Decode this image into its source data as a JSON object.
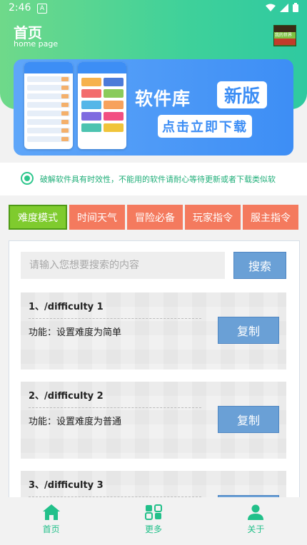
{
  "status_bar": {
    "time": "2:46",
    "a_icon": "A"
  },
  "header": {
    "title": "首页",
    "subtitle": "home page",
    "avatar_text": "我的世界"
  },
  "banner": {
    "headline": "软件库",
    "badge": "新版",
    "cta": "点击立即下载"
  },
  "notice": {
    "text": "破解软件具有时效性，不能用的软件请耐心等待更新或者下载类似软"
  },
  "tabs": [
    {
      "label": "难度模式",
      "active": true
    },
    {
      "label": "时间天气",
      "active": false
    },
    {
      "label": "冒险必备",
      "active": false
    },
    {
      "label": "玩家指令",
      "active": false
    },
    {
      "label": "服主指令",
      "active": false
    }
  ],
  "search": {
    "placeholder": "请输入您想要搜索的内容",
    "button_label": "搜索"
  },
  "commands": [
    {
      "command": "1、/difficulty 1",
      "description": "功能：设置难度为简单",
      "copy_label": "复制"
    },
    {
      "command": "2、/difficulty 2",
      "description": "功能：设置难度为普通",
      "copy_label": "复制"
    },
    {
      "command": "3、/difficulty 3",
      "description": "",
      "copy_label": "复制"
    }
  ],
  "bottom_nav": [
    {
      "label": "首页",
      "icon": "home-icon"
    },
    {
      "label": "更多",
      "icon": "more-icon"
    },
    {
      "label": "关于",
      "icon": "user-icon"
    }
  ],
  "colors": {
    "accent_green": "#2dc68c",
    "tab_orange": "#f47a5e",
    "tab_active": "#7fcb2e",
    "button_blue": "#6aa0d6",
    "banner_blue": "#3d8ef5"
  }
}
